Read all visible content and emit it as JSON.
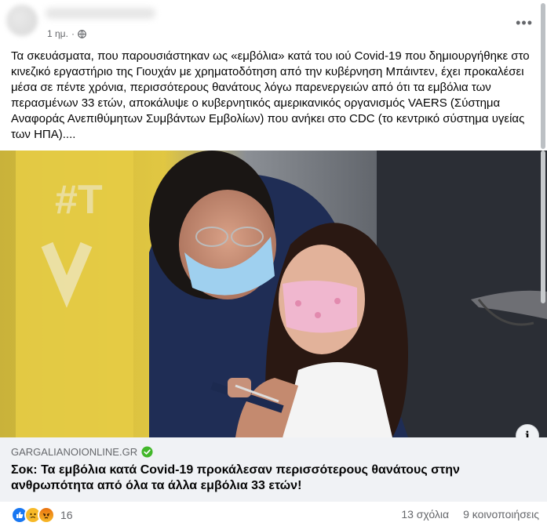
{
  "header": {
    "time": "1 ημ.",
    "separator": "·",
    "privacy_icon": "globe-icon",
    "more_icon": "more-horizontal-icon"
  },
  "post_text": "Τα σκευάσματα, που παρουσιάστηκαν ως «εμβόλια» κατά του ιού Covid-19 που δημιουργήθηκε στο κινεζικό εργαστήριο της Γιουχάν με χρηματοδότηση από την κυβέρνηση Μπάιντεν, έχει προκαλέσει μέσα σε πέντε χρόνια, περισσότερους θανάτους λόγω παρενεργειών από ότι τα εμβόλια των περασμένων 33 ετών, αποκάλυψε ο κυβερνητικός αμερικανικός οργανισμός VAERS (Σύστημα Αναφοράς Ανεπιθύμητων Συμβάντων Εμβολίων) που ανήκει στο CDC (το κεντρικό σύστημα υγείας των ΗΠΑ)....",
  "link": {
    "source": "GARGALIANOIONLINE.GR",
    "title": "Σοκ: Τα εμβόλια κατά Covid-19 προκάλεσαν περισσότερους θανάτους στην ανθρωπότητα από όλα τα άλλα εμβόλια 33 ετών!",
    "info_icon": "info-icon",
    "verified_icon": "verified-check-icon"
  },
  "footer": {
    "reactions": [
      "like-icon",
      "sad-icon",
      "angry-icon"
    ],
    "reaction_count": "16",
    "comments": "13 σχόλια",
    "shares": "9 κοινοποιήσεις"
  },
  "colors": {
    "link_background": "#f0f2f5",
    "secondary_text": "#65676b",
    "like_blue": "#1877f2",
    "verified_green": "#42b72a"
  }
}
